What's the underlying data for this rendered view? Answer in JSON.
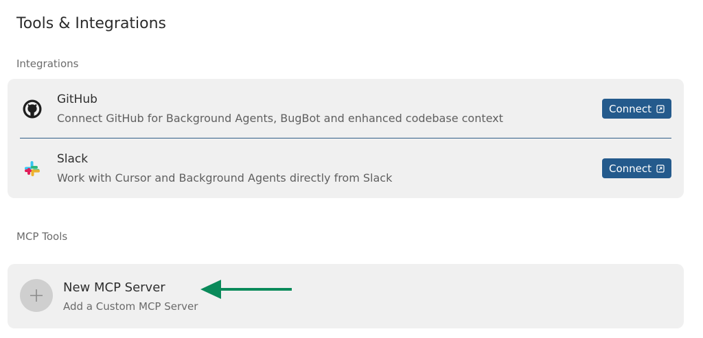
{
  "page": {
    "title": "Tools & Integrations"
  },
  "integrations": {
    "section_label": "Integrations",
    "items": [
      {
        "name": "GitHub",
        "description": "Connect GitHub for Background Agents, BugBot and enhanced codebase context",
        "button_label": "Connect",
        "icon": "github-icon"
      },
      {
        "name": "Slack",
        "description": "Work with Cursor and Background Agents directly from Slack",
        "button_label": "Connect",
        "icon": "slack-icon"
      }
    ]
  },
  "mcp": {
    "section_label": "MCP Tools",
    "new_server": {
      "title": "New MCP Server",
      "subtitle": "Add a Custom MCP Server",
      "icon": "plus-icon"
    }
  },
  "colors": {
    "accent": "#245a8c",
    "card_bg": "#f0f0f0",
    "annotation_arrow": "#0a8a5a"
  }
}
